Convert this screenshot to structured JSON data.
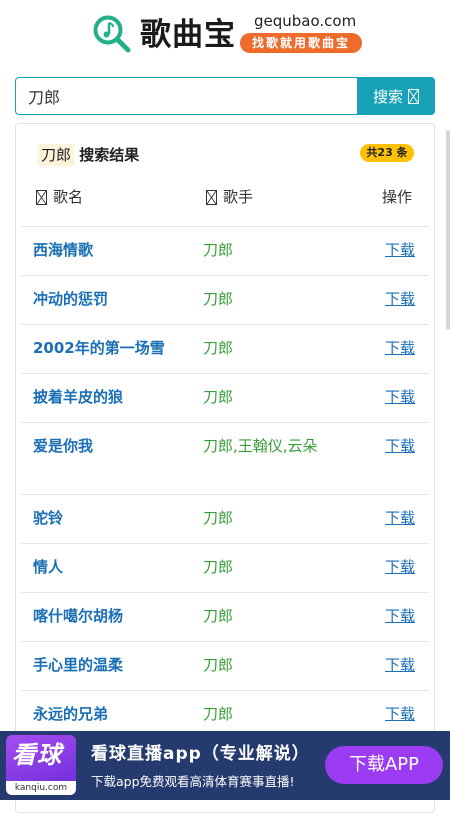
{
  "header": {
    "site_name": "歌曲宝",
    "domain": "gequbao.com",
    "slogan": "找歌就用歌曲宝"
  },
  "search": {
    "value": "刀郎",
    "button_label": "搜索"
  },
  "results": {
    "keyword": "刀郎",
    "title_suffix": "搜索结果",
    "count_label": "共23 条",
    "columns": {
      "song": "歌名",
      "singer": "歌手",
      "action": "操作"
    },
    "rows": [
      {
        "song": "西海情歌",
        "singer": "刀郎",
        "action": "下载"
      },
      {
        "song": "冲动的惩罚",
        "singer": "刀郎",
        "action": "下载"
      },
      {
        "song": "2002年的第一场雪",
        "singer": "刀郎",
        "action": "下载"
      },
      {
        "song": "披着羊皮的狼",
        "singer": "刀郎",
        "action": "下载"
      },
      {
        "song": "爱是你我",
        "singer": "刀郎,王翰仪,云朵",
        "action": "下载"
      },
      {
        "song": "驼铃",
        "singer": "刀郎",
        "action": "下载"
      },
      {
        "song": "情人",
        "singer": "刀郎",
        "action": "下载"
      },
      {
        "song": "喀什噶尔胡杨",
        "singer": "刀郎",
        "action": "下载"
      },
      {
        "song": "手心里的温柔",
        "singer": "刀郎",
        "action": "下载"
      },
      {
        "song": "永远的兄弟",
        "singer": "刀郎",
        "action": "下载"
      }
    ]
  },
  "ad": {
    "logo_text": "看球",
    "logo_domain": "kanqiu.com",
    "title": "看球直播app（专业解说）",
    "subtitle": "下载app免费观看高清体育赛事直播!",
    "button_label": "下载APP"
  },
  "colors": {
    "accent": "#17a2b8",
    "song_link": "#1a6fb5",
    "singer": "#3a9d3a",
    "badge": "#ffc107",
    "slogan": "#ef6b2c",
    "ad_bg": "#253a6e",
    "ad_button": "#9b3bf2"
  },
  "icons": {
    "logo": "music-search-icon",
    "search_button": "missing-glyph-icon",
    "song_column": "missing-glyph-icon",
    "singer_column": "missing-glyph-icon"
  }
}
